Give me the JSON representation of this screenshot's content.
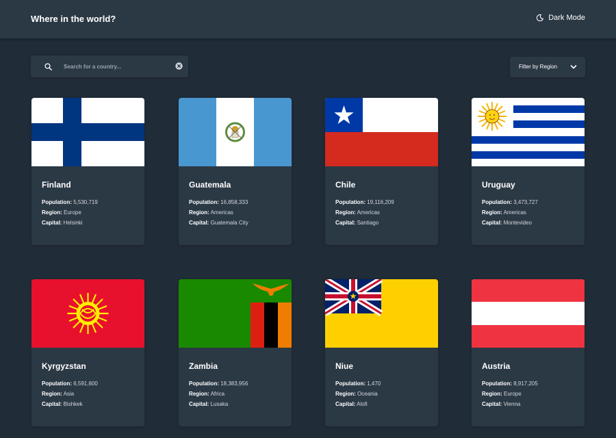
{
  "header": {
    "title": "Where in the world?",
    "mode_label": "Dark Mode",
    "mode_icon": "moon-icon"
  },
  "search": {
    "placeholder": "Search for a country...",
    "value": ""
  },
  "filter": {
    "label": "Filter by Region"
  },
  "labels": {
    "population": "Population:",
    "region": "Region:",
    "capital": "Capital:"
  },
  "countries": [
    {
      "name": "Finland",
      "population": "5,530,719",
      "region": "Europe",
      "capital": "Helsinki"
    },
    {
      "name": "Guatemala",
      "population": "16,858,333",
      "region": "Americas",
      "capital": "Guatemala City"
    },
    {
      "name": "Chile",
      "population": "19,116,209",
      "region": "Americas",
      "capital": "Santiago"
    },
    {
      "name": "Uruguay",
      "population": "3,473,727",
      "region": "Americas",
      "capital": "Montevideo"
    },
    {
      "name": "Kyrgyzstan",
      "population": "6,591,600",
      "region": "Asia",
      "capital": "Bishkek"
    },
    {
      "name": "Zambia",
      "population": "18,383,956",
      "region": "Africa",
      "capital": "Lusaka"
    },
    {
      "name": "Niue",
      "population": "1,470",
      "region": "Oceania",
      "capital": "Alofi"
    },
    {
      "name": "Austria",
      "population": "8,917,205",
      "region": "Europe",
      "capital": "Vienna"
    }
  ],
  "colors": {
    "background": "#202c37",
    "element": "#2b3945",
    "text": "#ffffff"
  }
}
